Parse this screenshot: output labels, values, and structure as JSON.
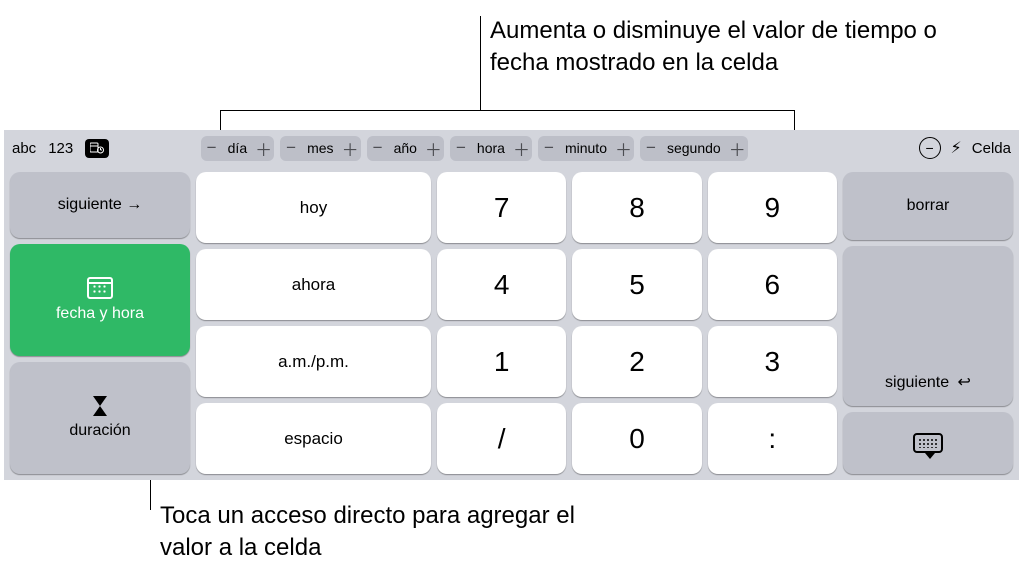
{
  "callouts": {
    "top": "Aumenta o disminuye el valor de tiempo o fecha mostrado en la celda",
    "bottom": "Toca un acceso directo para agregar el valor a la celda"
  },
  "toolbar": {
    "abc": "abc",
    "num": "123",
    "celda": "Celda",
    "steppers": [
      "día",
      "mes",
      "año",
      "hora",
      "minuto",
      "segundo"
    ]
  },
  "left": {
    "siguiente": "siguiente",
    "fecha_hora": "fecha y hora",
    "duracion": "duración"
  },
  "shortcuts": {
    "hoy": "hoy",
    "ahora": "ahora",
    "ampm": "a.m./p.m.",
    "espacio": "espacio"
  },
  "keypad": {
    "r1": [
      "7",
      "8",
      "9"
    ],
    "r2": [
      "4",
      "5",
      "6"
    ],
    "r3": [
      "1",
      "2",
      "3"
    ],
    "r4": [
      "/",
      "0",
      ":"
    ]
  },
  "right": {
    "borrar": "borrar",
    "siguiente": "siguiente"
  }
}
